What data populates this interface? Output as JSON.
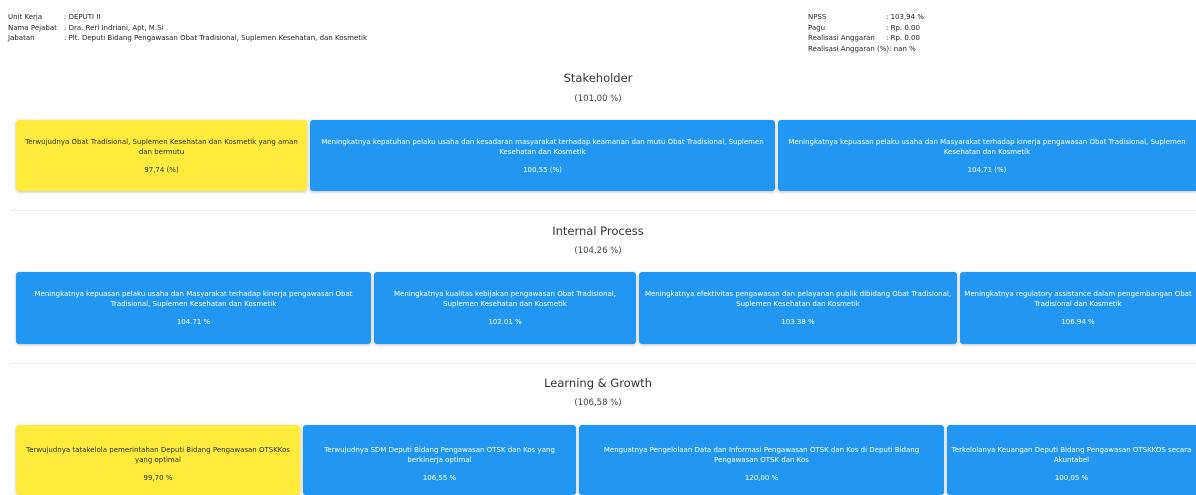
{
  "header": {
    "left": [
      {
        "label": "Unit Kerja",
        "value": ": DEPUTI II"
      },
      {
        "label": "Nama Pejabat",
        "value": ": Dra. Reri Indriani, Apt, M.Si"
      },
      {
        "label": "Jabatan",
        "value": ": Plt. Deputi Bidang Pengawasan Obat Tradisional, Suplemen Kesehatan, dan Kosmetik"
      }
    ],
    "right": [
      {
        "label": "NPSS",
        "value": ": 103,94 %"
      },
      {
        "label": "Pagu",
        "value": ": Rp. 0.00"
      },
      {
        "label": "Realisasi Anggaran",
        "value": ": Rp. 0.00"
      },
      {
        "label": "Realisasi Anggaran (%)",
        "value": ": nan %"
      }
    ]
  },
  "sections": [
    {
      "title": "Stakeholder",
      "percent": "(101,00 %)",
      "cards": [
        {
          "text": "Terwujudnya Obat Tradisional, Suplemen Kesehatan dan Kosmetik yang aman dan bermutu",
          "value": "97,74 (%)",
          "color": "yellow"
        },
        {
          "text": "Meningkatnya kepatuhan pelaku usaha dan kesadaran masyarakat terhadap keamanan dan mutu Obat Tradisional, Suplemen Kesehatan dan Kosmetik",
          "value": "100,55 (%)",
          "color": "blue"
        },
        {
          "text": "Meningkatnya kepuasan pelaku usaha dan Masyarakat terhadap kinerja pengawasan Obat Tradisional, Suplemen Kesehatan dan Kosmetik",
          "value": "104,71 (%)",
          "color": "blue"
        }
      ]
    },
    {
      "title": "Internal Process",
      "percent": "(104,26 %)",
      "cards": [
        {
          "text": "Meningkatnya kepuasan pelaku usaha dan Masyarakat terhadap kinerja pengawasan Obat Tradisional, Suplemen Kesehatan dan Kosmetik",
          "value": "104.71 %",
          "color": "blue"
        },
        {
          "text": "Meningkatnya kualitas kebijakan pengawasan Obat Tradisional, Suplemen Kesehatan dan Kosmetik",
          "value": "102.01 %",
          "color": "blue"
        },
        {
          "text": "Meningkatnya efektivitas pengawasan dan pelayanan publik dibidang Obat Tradisional, Suplemen Kesehatan dan Kosmetik",
          "value": "103.38 %",
          "color": "blue"
        },
        {
          "text": "Meningkatnya regulatory assistance dalam pengembangan Obat Tradisional dan Kosmetik",
          "value": "106.94 %",
          "color": "blue"
        }
      ]
    },
    {
      "title": "Learning & Growth",
      "percent": "(106,58 %)",
      "cards": [
        {
          "text": "Terwujudnya tatakelola pemerintahan Deputi Bidang Pengawasan OTSKKos yang optimal",
          "value": "99,70 %",
          "color": "yellow"
        },
        {
          "text": "Terwujudnya SDM Deputi Bidang Pengawasan OTSK dan Kos yang berkinerja optimal",
          "value": "106,55 %",
          "color": "blue"
        },
        {
          "text": "Menguatnya Pengelolaan Data dan Informasi Pengawasan OTSK dan Kos di Deputi Bidang Pengawasan OTSK dan Kos",
          "value": "120,00 %",
          "color": "blue"
        },
        {
          "text": "Terkelolanya Keuangan Deputi Bidang Pengawasan OTSKKOS secara Akuntabel",
          "value": "100,05 %",
          "color": "blue"
        }
      ]
    }
  ],
  "colors": {
    "blue": "#2196f3",
    "yellow": "#ffeb3b"
  }
}
